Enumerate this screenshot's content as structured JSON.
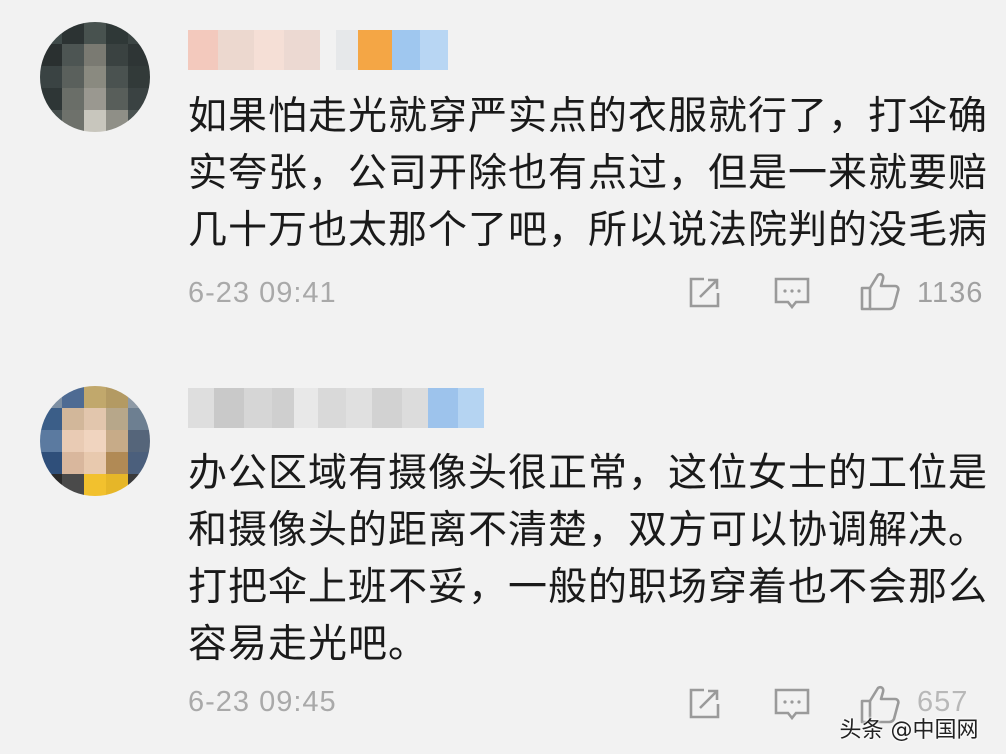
{
  "comments": [
    {
      "lines": [
        "如果怕走光就穿严实点的衣服就行了，打伞确",
        "实夸张，公司开除也有点过，但是一来就要赔",
        "几十万也太那个了吧，所以说法院判的没毛病"
      ],
      "timestamp": "6-23 09:41",
      "like_count": "1136"
    },
    {
      "lines": [
        "办公区域有摄像头很正常，这位女士的工位是",
        "和摄像头的距离不清楚，双方可以协调解决。",
        "打把伞上班不妥，一般的职场穿着也不会那么",
        "容易走光吧。"
      ],
      "timestamp": "6-23 09:45",
      "like_count": "657"
    }
  ],
  "watermark": "头条 @中国网",
  "icons": [
    "share-icon",
    "reply-icon",
    "like-icon"
  ],
  "colors": {
    "background": "#f2f2f2",
    "text": "#1a1a1a",
    "meta": "#a9a9a9"
  }
}
